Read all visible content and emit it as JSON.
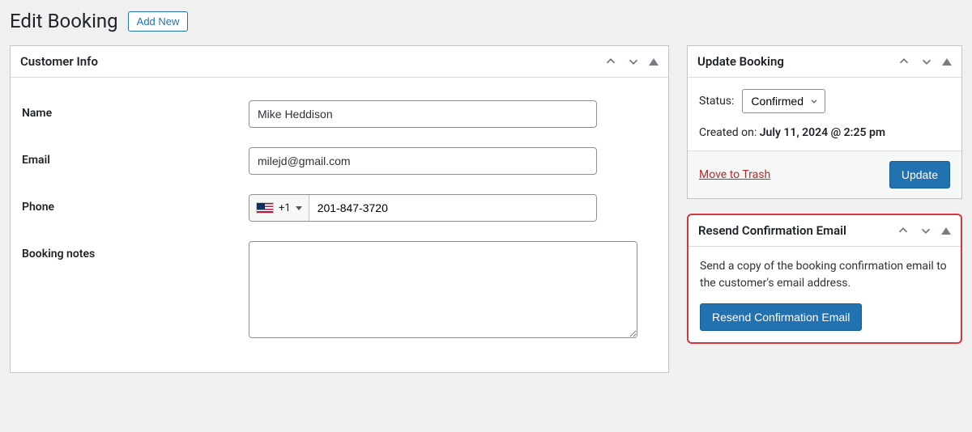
{
  "header": {
    "title": "Edit Booking",
    "add_new_label": "Add New"
  },
  "customer_info": {
    "panel_title": "Customer Info",
    "name_label": "Name",
    "name_value": "Mike Heddison",
    "email_label": "Email",
    "email_value": "milejd@gmail.com",
    "phone_label": "Phone",
    "phone_country": "+1",
    "phone_value": "201-847-3720",
    "notes_label": "Booking notes",
    "notes_value": ""
  },
  "update_panel": {
    "title": "Update Booking",
    "status_label": "Status:",
    "status_value": "Confirmed",
    "created_label": "Created on:",
    "created_value": "July 11, 2024 @ 2:25 pm",
    "trash_label": "Move to Trash",
    "update_label": "Update"
  },
  "resend_panel": {
    "title": "Resend Confirmation Email",
    "description": "Send a copy of the booking confirmation email to the customer's email address.",
    "button_label": "Resend Confirmation Email"
  }
}
